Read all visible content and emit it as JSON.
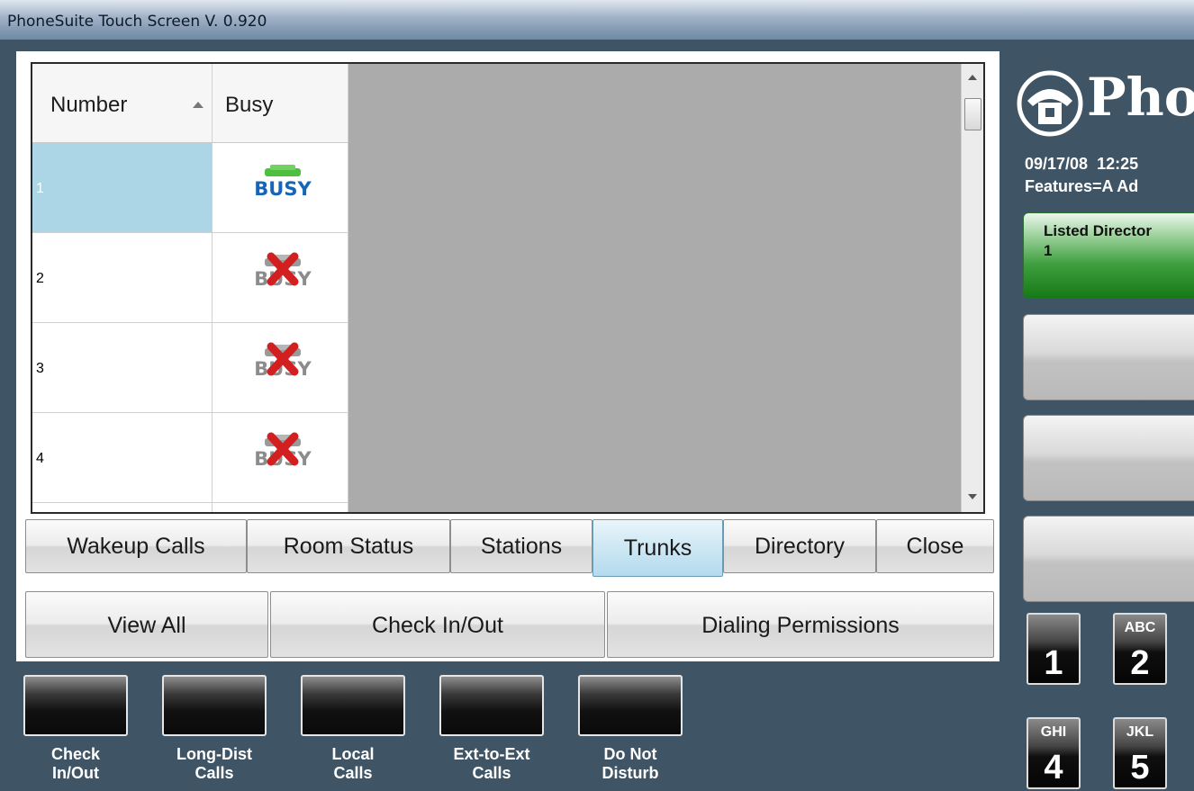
{
  "window": {
    "title": "PhoneSuite Touch Screen V. 0.920"
  },
  "grid": {
    "columns": [
      "Number",
      "Busy"
    ],
    "rows": [
      {
        "number": "1",
        "busy_icon": "busy-active-icon"
      },
      {
        "number": "2",
        "busy_icon": "busy-disabled-icon"
      },
      {
        "number": "3",
        "busy_icon": "busy-disabled-icon"
      },
      {
        "number": "4",
        "busy_icon": "busy-disabled-icon"
      }
    ],
    "busy_text": "BUSY"
  },
  "tabs": {
    "wakeup": "Wakeup Calls",
    "room_status": "Room Status",
    "stations": "Stations",
    "trunks": "Trunks",
    "directory": "Directory",
    "close": "Close"
  },
  "actions": {
    "view_all": "View All",
    "check_in_out": "Check In/Out",
    "dialing_permissions": "Dialing Permissions"
  },
  "feature_buttons": [
    {
      "line1": "Check",
      "line2": "In/Out"
    },
    {
      "line1": "Long-Dist",
      "line2": "Calls"
    },
    {
      "line1": "Local",
      "line2": "Calls"
    },
    {
      "line1": "Ext-to-Ext",
      "line2": "Calls"
    },
    {
      "line1": "Do Not",
      "line2": "Disturb"
    }
  ],
  "sidebar": {
    "logo_text": "Pho",
    "date": "09/17/08",
    "time": "12:25",
    "features": "Features=A Ad",
    "listed_title": "Listed Director",
    "listed_value": "1"
  },
  "keypad": [
    {
      "letters": "",
      "digit": "1"
    },
    {
      "letters": "ABC",
      "digit": "2"
    },
    {
      "letters": "GHI",
      "digit": "4"
    },
    {
      "letters": "JKL",
      "digit": "5"
    }
  ],
  "colors": {
    "background": "#3f5566",
    "selected_row": "#acd5e6",
    "active_tab": "#b3dbee",
    "listed_green": "#3f9f3f"
  }
}
